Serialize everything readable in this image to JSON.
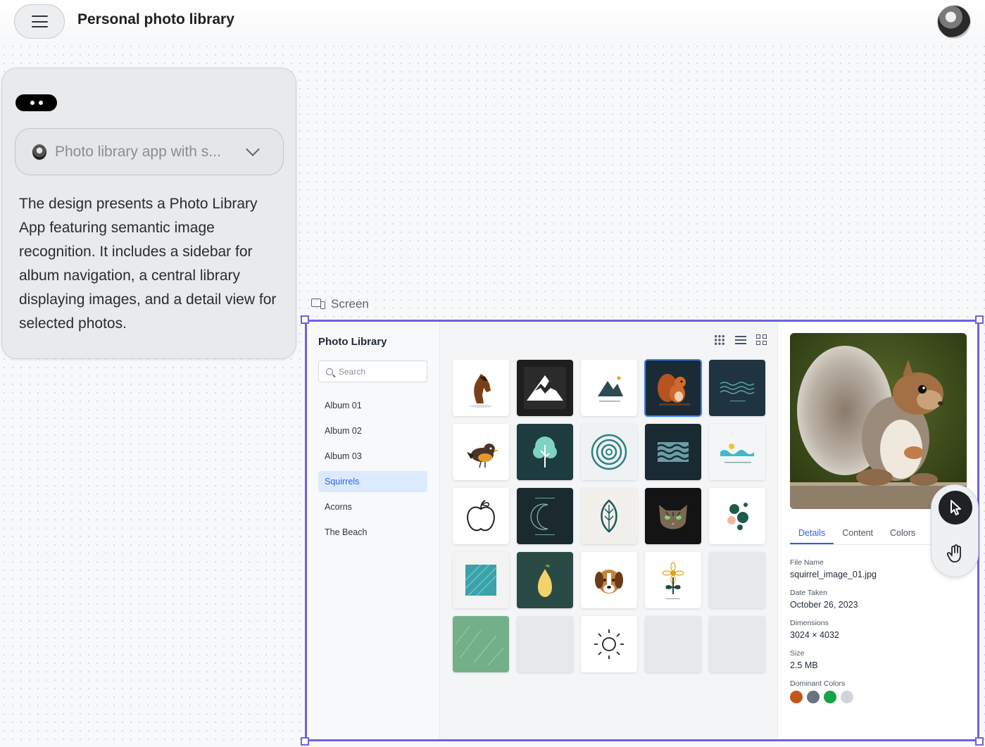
{
  "header": {
    "title": "Personal photo library"
  },
  "assistant_panel": {
    "prompt_select_text": "Photo library app with s...",
    "description": "The design presents a Photo Library App featuring semantic image recognition. It includes a sidebar for album navigation, a central library displaying images, and a detail view for selected photos."
  },
  "canvas": {
    "screen_label": "Screen"
  },
  "app": {
    "sidebar": {
      "title": "Photo Library",
      "search_placeholder": "Search",
      "albums": [
        {
          "label": "Album 01",
          "active": false
        },
        {
          "label": "Album 02",
          "active": false
        },
        {
          "label": "Album 03",
          "active": false
        },
        {
          "label": "Squirrels",
          "active": true
        },
        {
          "label": "Acorns",
          "active": false
        },
        {
          "label": "The Beach",
          "active": false
        }
      ]
    },
    "view_toggles": [
      "grid-small-icon",
      "list-icon",
      "grid-large-icon"
    ],
    "thumbnails": [
      {
        "name": "thumb-horse",
        "icon": "horse",
        "bg": "#ffffff"
      },
      {
        "name": "thumb-dark-mountain",
        "icon": "dark-mountain",
        "bg": "#1e1e1e"
      },
      {
        "name": "thumb-mountain-logo",
        "icon": "mountain-logo",
        "bg": "#ffffff"
      },
      {
        "name": "thumb-squirrel",
        "icon": "squirrel",
        "bg": "#1c2a36",
        "selected": true
      },
      {
        "name": "thumb-waves-dark",
        "icon": "waves-dark",
        "bg": "#1f3440"
      },
      {
        "name": "thumb-bird",
        "icon": "bird",
        "bg": "#ffffff"
      },
      {
        "name": "thumb-tree",
        "icon": "tree",
        "bg": "#1e3b40"
      },
      {
        "name": "thumb-spiral",
        "icon": "spiral",
        "bg": "#eef2f3"
      },
      {
        "name": "thumb-waves-pattern",
        "icon": "waves-pattern",
        "bg": "#1a2a33"
      },
      {
        "name": "thumb-wave-logo",
        "icon": "wave-logo",
        "bg": "#f3f5f6"
      },
      {
        "name": "thumb-apple",
        "icon": "apple",
        "bg": "#ffffff"
      },
      {
        "name": "thumb-moon",
        "icon": "moon",
        "bg": "#1b2a2e"
      },
      {
        "name": "thumb-leaf",
        "icon": "leaf",
        "bg": "#f1f0ec"
      },
      {
        "name": "thumb-cat",
        "icon": "cat",
        "bg": "#141414"
      },
      {
        "name": "thumb-abstract-circles",
        "icon": "abstract-circles",
        "bg": "#ffffff"
      },
      {
        "name": "thumb-teal-texture",
        "icon": "teal-texture",
        "bg": "#f3f3f3"
      },
      {
        "name": "thumb-pear",
        "icon": "pear",
        "bg": "#2a4a46"
      },
      {
        "name": "thumb-dog",
        "icon": "dog",
        "bg": "#ffffff"
      },
      {
        "name": "thumb-flower",
        "icon": "flower",
        "bg": "#ffffff"
      },
      {
        "name": "thumb-empty-1",
        "icon": "empty",
        "bg": "#e6e9ec"
      },
      {
        "name": "thumb-green-texture",
        "icon": "green-texture",
        "bg": "#73b08a"
      },
      {
        "name": "thumb-empty-2",
        "icon": "empty",
        "bg": "#e6e9ec"
      },
      {
        "name": "thumb-sun",
        "icon": "sun",
        "bg": "#ffffff"
      },
      {
        "name": "thumb-empty-3",
        "icon": "empty",
        "bg": "#e6e9ec"
      },
      {
        "name": "thumb-empty-4",
        "icon": "empty",
        "bg": "#e6e9ec"
      }
    ],
    "detail": {
      "tabs": [
        {
          "label": "Details",
          "active": true
        },
        {
          "label": "Content",
          "active": false
        },
        {
          "label": "Colors",
          "active": false
        }
      ],
      "fields": [
        {
          "label": "File Name",
          "value": "squirrel_image_01.jpg"
        },
        {
          "label": "Date Taken",
          "value": "October 26, 2023"
        },
        {
          "label": "Dimensions",
          "value": "3024 × 4032"
        },
        {
          "label": "Size",
          "value": "2.5 MB"
        }
      ],
      "dominant_colors_label": "Dominant Colors",
      "dominant_colors": [
        "#c2571a",
        "#6b7280",
        "#16a34a",
        "#d1d5db"
      ]
    }
  },
  "tools": {
    "active": "pointer-icon",
    "items": [
      "pointer-icon",
      "hand-icon"
    ]
  },
  "colors": {
    "selection_frame": "#6d63e0",
    "accent": "#2563eb"
  }
}
